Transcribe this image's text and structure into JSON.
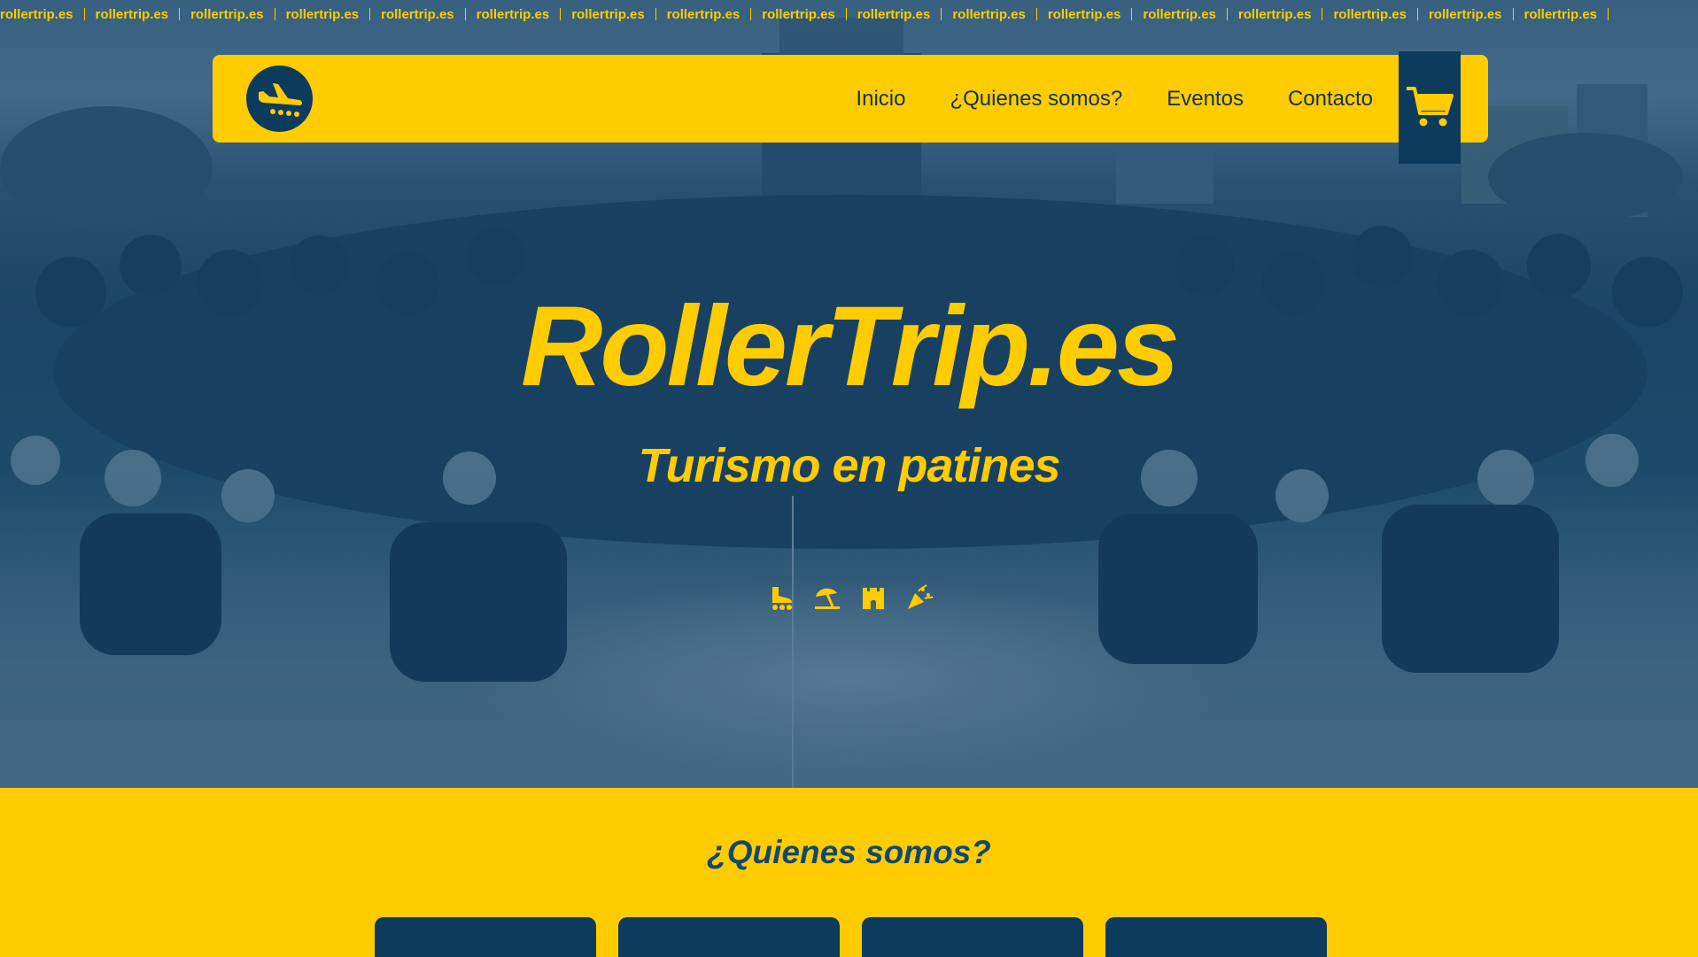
{
  "marquee": {
    "text": "rollertrip.es",
    "repeat": 17
  },
  "header": {
    "logo_icon": "plane-landing-icon",
    "nav": [
      {
        "label": "Inicio"
      },
      {
        "label": "¿Quienes somos?"
      },
      {
        "label": "Eventos"
      },
      {
        "label": "Contacto"
      }
    ],
    "cart_icon": "shopping-cart-icon"
  },
  "hero": {
    "title": "RollerTrip.es",
    "subtitle": "Turismo en patines",
    "icons": [
      "inline-skate-icon",
      "beach-umbrella-icon",
      "castle-icon",
      "party-popper-icon"
    ]
  },
  "about": {
    "title": "¿Quienes somos?",
    "cards": 4
  },
  "colors": {
    "brand_yellow": "#ffcc00",
    "brand_navy": "#0d3b5e"
  }
}
